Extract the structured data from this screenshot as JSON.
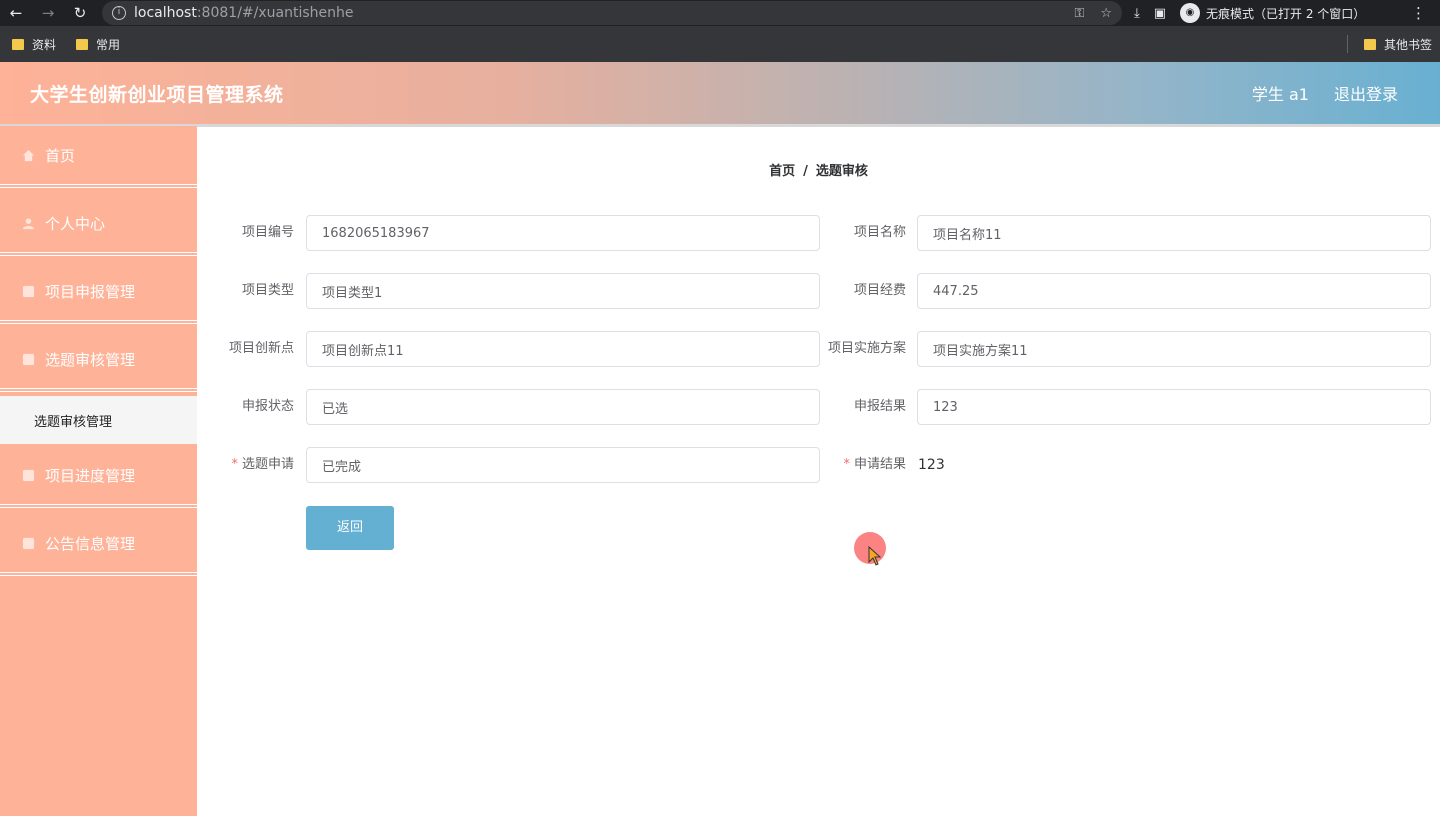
{
  "browser": {
    "url_host": "localhost",
    "url_path": ":8081/#/xuantishenhe",
    "incognito_label": "无痕模式（已打开 2 个窗口）",
    "bookmarks": [
      "资料",
      "常用"
    ],
    "other_bookmarks": "其他书签"
  },
  "header": {
    "title": "大学生创新创业项目管理系统",
    "user": "学生 a1",
    "logout": "退出登录"
  },
  "sidebar": {
    "items": [
      {
        "label": "首页",
        "icon": "home-icon"
      },
      {
        "label": "个人中心",
        "icon": "user-icon"
      },
      {
        "label": "项目申报管理",
        "icon": "menu-icon"
      },
      {
        "label": "选题审核管理",
        "icon": "menu-icon"
      },
      {
        "label": "项目进度管理",
        "icon": "menu-icon"
      },
      {
        "label": "公告信息管理",
        "icon": "menu-icon"
      }
    ],
    "sub_item": "选题审核管理"
  },
  "breadcrumb": {
    "home": "首页",
    "sep": "/",
    "current": "选题审核"
  },
  "form": {
    "xiangmubianhao": {
      "label": "项目编号",
      "value": "1682065183967"
    },
    "xiangmumingcheng": {
      "label": "项目名称",
      "value": "项目名称11"
    },
    "xiangmuleixing": {
      "label": "项目类型",
      "value": "项目类型1"
    },
    "xiangmujingfei": {
      "label": "项目经费",
      "value": "447.25"
    },
    "chuangxindian": {
      "label": "项目创新点",
      "value": "项目创新点11"
    },
    "shishifangan": {
      "label": "项目实施方案",
      "value": "项目实施方案11"
    },
    "shenbaozhuangtai": {
      "label": "申报状态",
      "value": "已选"
    },
    "shenbaojieguo": {
      "label": "申报结果",
      "value": "123"
    },
    "xuantishenqing": {
      "label": "选题申请",
      "value": "已完成",
      "required": "*"
    },
    "shenqingjieguo": {
      "label": "申请结果",
      "value": "123",
      "required": "*"
    }
  },
  "buttons": {
    "back": "返回"
  },
  "colors": {
    "sidebar": "#feb297",
    "button": "#63b0d2",
    "required": "#f56c6c"
  }
}
